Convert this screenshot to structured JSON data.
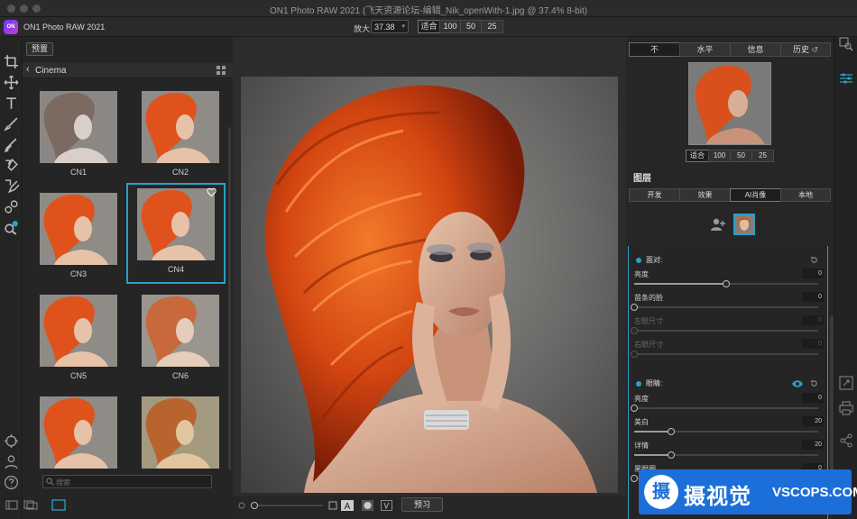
{
  "window": {
    "title": "ON1 Photo RAW 2021 (飞天资源论坛-编辑_Nik_openWith-1.jpg @ 37.4% 8-bit)"
  },
  "toolbar": {
    "app_logo_text": "ON",
    "app_name": "ON1 Photo RAW 2021",
    "zoom_label": "放大",
    "zoom_value": "37.38",
    "zoom_fit": "适合",
    "zoom_presets": [
      "100",
      "50",
      "25"
    ]
  },
  "browser": {
    "preset_button": "预置",
    "category": "Cinema",
    "presets": [
      {
        "label": "CN1",
        "tone": "mono"
      },
      {
        "label": "CN2",
        "tone": "warm"
      },
      {
        "label": "CN3",
        "tone": "warm"
      },
      {
        "label": "CN4",
        "tone": "warm",
        "selected": true
      },
      {
        "label": "CN5",
        "tone": "warm"
      },
      {
        "label": "CN6",
        "tone": "muted"
      },
      {
        "label": "",
        "tone": "warm"
      },
      {
        "label": "",
        "tone": "vintage"
      }
    ],
    "search_placeholder": "搜索"
  },
  "canvas": {
    "preview_button": "预习"
  },
  "right_panel": {
    "view_tabs": [
      "不",
      "水平",
      "信息",
      "历史"
    ],
    "active_view_tab": "不",
    "nav_fit": "适合",
    "nav_presets": [
      "100",
      "50",
      "25"
    ],
    "layers_title": "图层",
    "layer_tabs": [
      "开发",
      "效果",
      "AI肖像",
      "本地"
    ],
    "active_layer_tab": "AI肖像",
    "face_section": {
      "title": "面对:",
      "sliders": [
        {
          "label": "亮度",
          "value": "0",
          "level": 0.5,
          "enabled": true
        },
        {
          "label": "苗条的脸",
          "value": "0",
          "level": 0,
          "enabled": true
        },
        {
          "label": "左眼尺寸",
          "value": "0",
          "level": 0,
          "enabled": false
        },
        {
          "label": "右眼尺寸",
          "value": "0",
          "level": 0,
          "enabled": false
        }
      ]
    },
    "eyes_section": {
      "title": "眼睛:",
      "sliders": [
        {
          "label": "亮度",
          "value": "0",
          "level": 0,
          "enabled": true
        },
        {
          "label": "美白",
          "value": "20",
          "level": 0.2,
          "enabled": true
        },
        {
          "label": "详情",
          "value": "20",
          "level": 0.2,
          "enabled": true
        },
        {
          "label": "黑眼圈",
          "value": "0",
          "level": 0,
          "enabled": true
        }
      ]
    }
  },
  "watermark": {
    "logo_char": "摄",
    "name": "摄视觉",
    "site": "VSCOPS.COM"
  },
  "colors": {
    "accent": "#2aa0c8",
    "panel": "#262626",
    "hair": "#e0521c"
  }
}
